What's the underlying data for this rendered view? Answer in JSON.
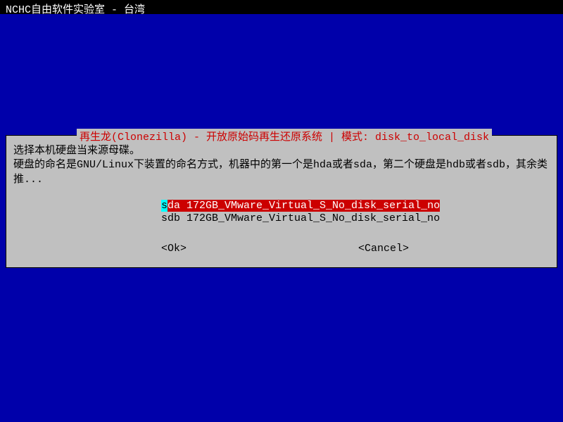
{
  "header": {
    "title": "NCHC自由软件实验室 - 台湾"
  },
  "dialog": {
    "title": "再生龙(Clonezilla) - 开放原始码再生还原系统 | 模式: disk_to_local_disk",
    "description_line1": "选择本机硬盘当来源母碟。",
    "description_line2": "硬盘的命名是GNU/Linux下装置的命名方式，机器中的第一个是hda或者sda，第二个硬盘是hdb或者sdb，其余类推...",
    "disks": [
      {
        "first_char": "s",
        "rest": "da 172GB_VMware_Virtual_S_No_disk_serial_no",
        "selected": true
      },
      {
        "full": "sdb 172GB_VMware_Virtual_S_No_disk_serial_no",
        "selected": false
      }
    ],
    "buttons": {
      "ok": "<Ok>",
      "cancel": "<Cancel>"
    }
  }
}
